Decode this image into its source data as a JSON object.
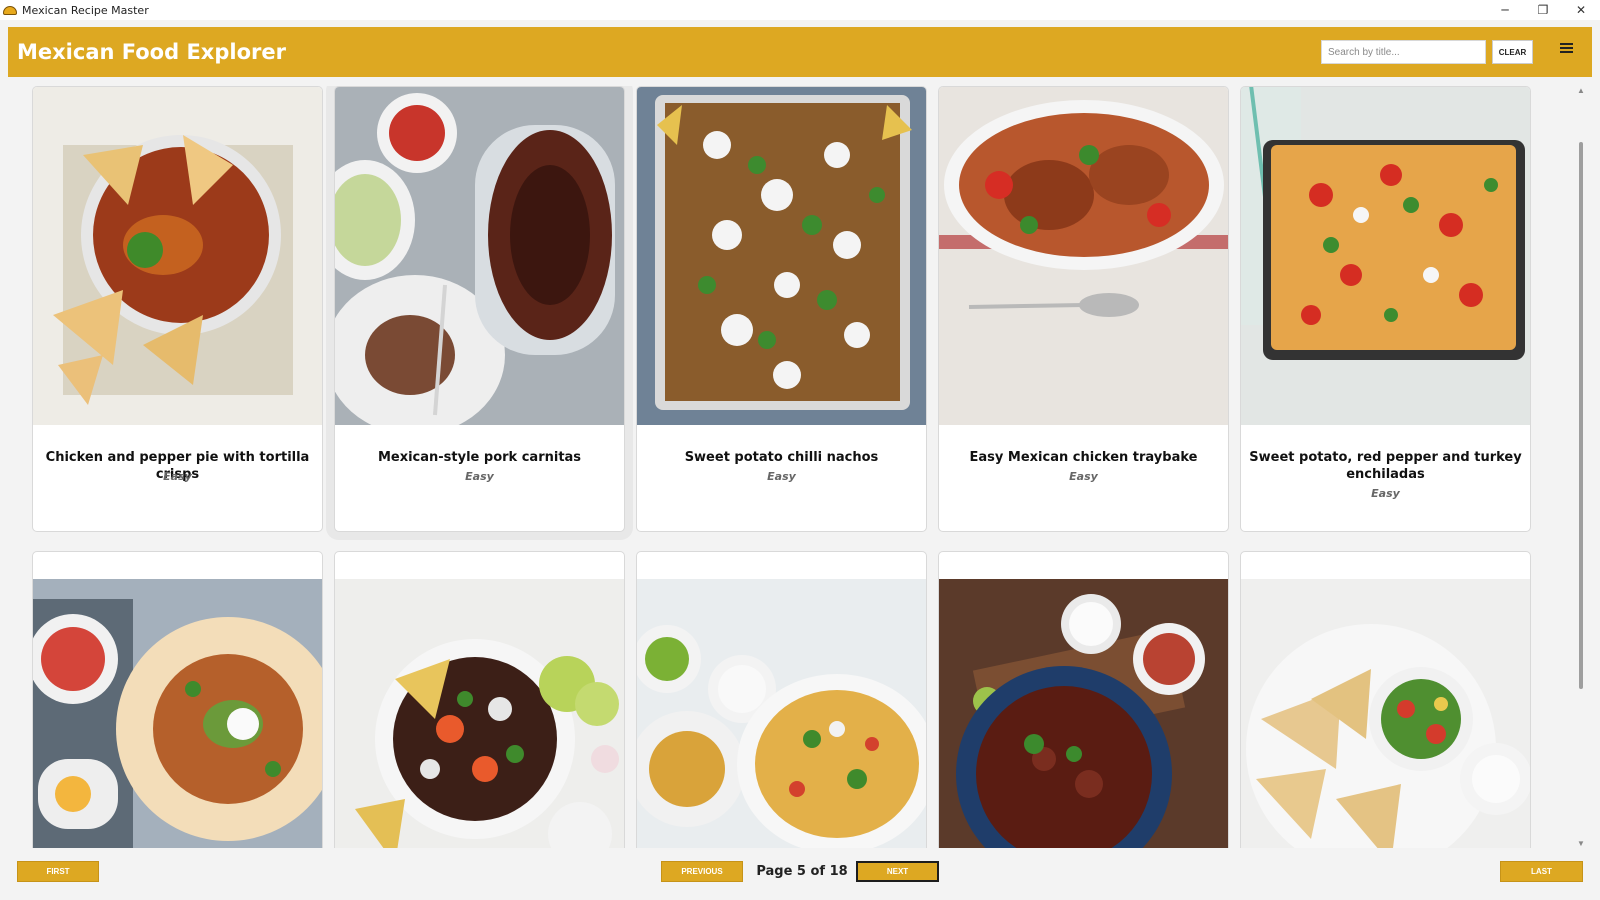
{
  "window": {
    "title": "Mexican Recipe Master",
    "controls": {
      "minimize": "─",
      "restore": "❐",
      "close": "✕"
    }
  },
  "header": {
    "title": "Mexican Food Explorer",
    "search_placeholder": "Search by title...",
    "search_value": "",
    "clear_label": "CLEAR",
    "menu_icon": "hamburger-icon"
  },
  "colors": {
    "accent": "#dda822",
    "background": "#f3f3f3",
    "card": "#ffffff"
  },
  "recipes": [
    {
      "title": "Chicken and pepper pie with tortilla crisps",
      "difficulty": "Easy",
      "image": "chicken-pepper-pie-photo"
    },
    {
      "title": "Mexican-style pork carnitas",
      "difficulty": "Easy",
      "image": "pork-carnitas-photo"
    },
    {
      "title": "Sweet potato chilli nachos",
      "difficulty": "Easy",
      "image": "sweet-potato-nachos-photo"
    },
    {
      "title": "Easy Mexican chicken traybake",
      "difficulty": "Easy",
      "image": "chicken-traybake-photo"
    },
    {
      "title": "Sweet potato, red pepper and turkey enchiladas",
      "difficulty": "Easy",
      "image": "turkey-enchiladas-photo"
    },
    {
      "image": "breakfast-tortilla-photo"
    },
    {
      "image": "chicken-tortilla-bowl-photo"
    },
    {
      "image": "enchilada-bake-photo"
    },
    {
      "image": "beef-chilli-pot-photo"
    },
    {
      "image": "quesadillas-salad-photo"
    }
  ],
  "pagination": {
    "first": "FIRST",
    "previous": "PREVIOUS",
    "page_text": "Page 5 of 18",
    "current_page": 5,
    "total_pages": 18,
    "next": "NEXT",
    "last": "LAST"
  }
}
